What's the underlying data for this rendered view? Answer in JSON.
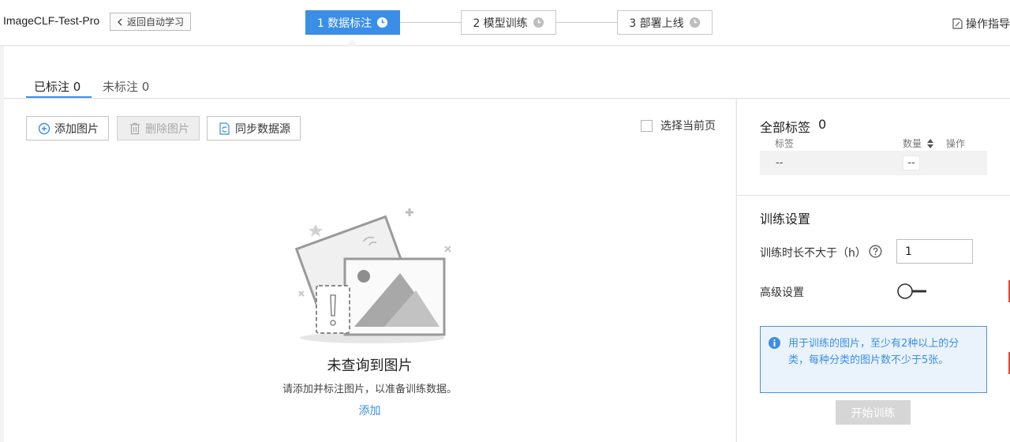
{
  "header": {
    "app_title": "ImageCLF-Test-Pro",
    "back_label": "返回自动学习",
    "steps": [
      {
        "label": "1 数据标注",
        "active": true
      },
      {
        "label": "2 模型训练",
        "active": false
      },
      {
        "label": "3 部署上线",
        "active": false
      }
    ],
    "guide_label": "操作指导"
  },
  "tabs": [
    {
      "label": "已标注 0",
      "active": true
    },
    {
      "label": "未标注 0",
      "active": false
    }
  ],
  "toolbar": {
    "add_label": "添加图片",
    "delete_label": "删除图片",
    "sync_label": "同步数据源",
    "select_page_label": "选择当前页"
  },
  "empty_state": {
    "title": "未查询到图片",
    "subtitle": "请添加并标注图片，以准备训练数据。",
    "link": "添加"
  },
  "labels_panel": {
    "title": "全部标签",
    "count": "0",
    "col_label": "标签",
    "col_count": "数量",
    "col_action": "操作",
    "row_label": "--",
    "row_count": "--"
  },
  "training": {
    "title": "训练设置",
    "duration_label": "训练时长不大于（h）",
    "duration_value": "1",
    "advanced_label": "高级设置",
    "advanced_enabled": false,
    "info_text": "用于训练的图片，至少有2种以上的分类，每种分类的图片数不少于5张。",
    "start_label": "开始训练"
  },
  "colors": {
    "accent": "#3a8ee6",
    "disabled_button": "#d6d6d6",
    "info_bg": "#eaf3fb",
    "edge_marker": "#e04b3c"
  }
}
